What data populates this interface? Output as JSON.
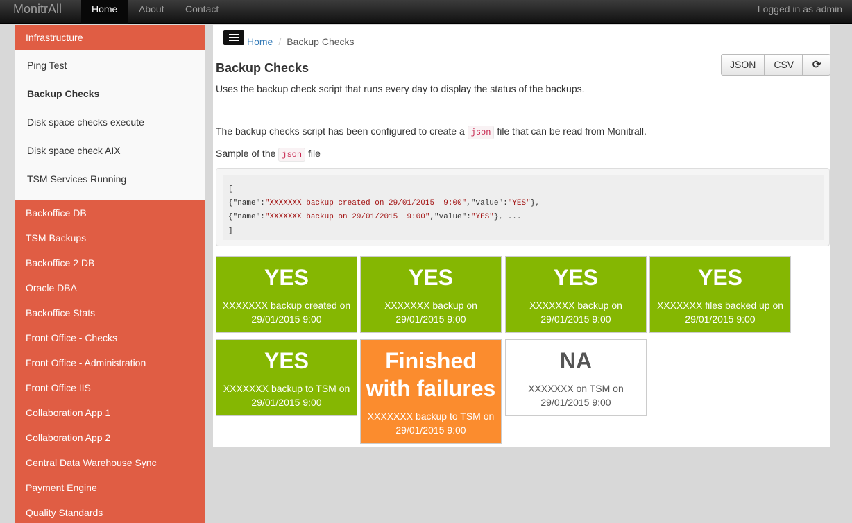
{
  "navbar": {
    "brand": "MonitrAll",
    "links": [
      {
        "label": "Home"
      },
      {
        "label": "About"
      },
      {
        "label": "Contact"
      }
    ],
    "user_status": "Logged in as admin"
  },
  "sidebar": {
    "group_title": "Infrastructure",
    "sub_items": [
      {
        "label": "Ping Test"
      },
      {
        "label": "Backup Checks",
        "active": true
      },
      {
        "label": "Disk space checks execute"
      },
      {
        "label": "Disk space check AIX"
      },
      {
        "label": "TSM Services Running"
      }
    ],
    "items": [
      {
        "label": "Backoffice DB"
      },
      {
        "label": "TSM Backups"
      },
      {
        "label": "Backoffice 2 DB"
      },
      {
        "label": "Oracle DBA"
      },
      {
        "label": "Backoffice Stats"
      },
      {
        "label": "Front Office - Checks"
      },
      {
        "label": "Front Office - Administration"
      },
      {
        "label": "Front Office IIS"
      },
      {
        "label": "Collaboration App 1"
      },
      {
        "label": "Collaboration App 2"
      },
      {
        "label": "Central Data Warehouse Sync"
      },
      {
        "label": "Payment Engine"
      },
      {
        "label": "Quality Standards"
      }
    ]
  },
  "breadcrumb": {
    "home": "Home",
    "current": "Backup Checks"
  },
  "page": {
    "title": "Backup Checks",
    "description": "Uses the backup check script that runs every day to display the status of the backups.",
    "para1_before": "The backup checks script has been configured to create a",
    "para1_code": "json",
    "para1_after": "file that can be read from Monitrall.",
    "para2_before": "Sample of the",
    "para2_code": "json",
    "para2_after": "file",
    "buttons": {
      "json": "JSON",
      "csv": "CSV"
    },
    "code_lines": {
      "line1": "[",
      "line2_a": "{\"name\":",
      "line2_b": "\"XXXXXXX backup created on 29/01/2015  9:00\"",
      "line2_c": ",\"value\":",
      "line2_d": "\"YES\"",
      "line2_e": "},",
      "line3_a": "{\"name\":",
      "line3_b": "\"XXXXXXX backup on 29/01/2015  9:00\"",
      "line3_c": ",\"value\":",
      "line3_d": "\"YES\"",
      "line3_e": "}, ...",
      "line4": "]"
    }
  },
  "tiles": [
    {
      "value": "YES",
      "label": "XXXXXXX backup created on 29/01/2015 9:00",
      "status": "ok"
    },
    {
      "value": "YES",
      "label": "XXXXXXX backup on 29/01/2015 9:00",
      "status": "ok"
    },
    {
      "value": "YES",
      "label": "XXXXXXX backup on 29/01/2015 9:00",
      "status": "ok"
    },
    {
      "value": "YES",
      "label": "XXXXXXX files backed up on 29/01/2015 9:00",
      "status": "ok"
    },
    {
      "value": "YES",
      "label": "XXXXXXX backup to TSM on 29/01/2015 9:00",
      "status": "ok"
    },
    {
      "value": "Finished with failures",
      "label": "XXXXXXX backup to TSM on 29/01/2015 9:00",
      "status": "warn"
    },
    {
      "value": "NA",
      "label": "XXXXXXX on TSM on 29/01/2015 9:00",
      "status": "na"
    }
  ],
  "colors": {
    "ok": "#85b702",
    "warn": "#fb8c2e",
    "na": "#ffffff",
    "sidebar": "#e05d44",
    "link": "#337ab7"
  }
}
